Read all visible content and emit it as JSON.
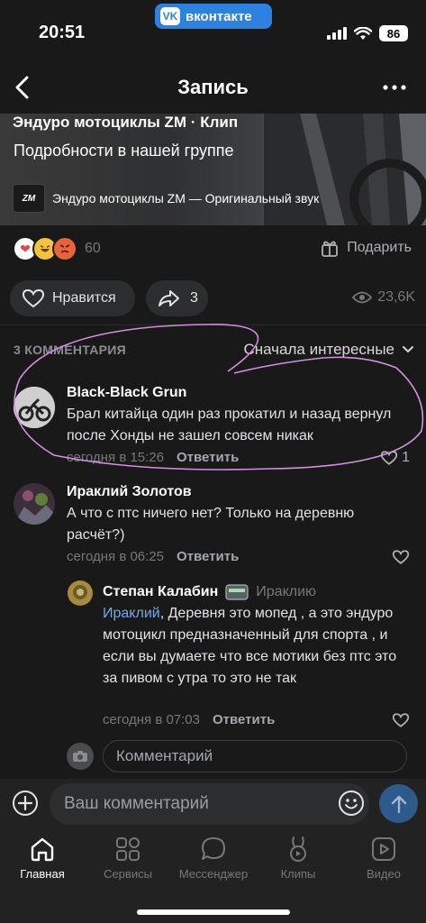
{
  "status_bar": {
    "time": "20:51",
    "app_pill": "вконтакте",
    "app_pill_logo": "VK",
    "battery": "86"
  },
  "header": {
    "title": "Запись"
  },
  "clip": {
    "title": "Эндуро мотоциклы ZM · Клип",
    "subtitle": "Подробности в нашей группе",
    "audio_logo": "ZM",
    "audio": "Эндуро мотоциклы ZM — Оригинальный звук"
  },
  "reactions": {
    "count": "60",
    "gift_label": "Подарить"
  },
  "actions": {
    "like_label": "Нравится",
    "share_count": "3",
    "views": "23,6K"
  },
  "comments_section": {
    "count_label": "3 КОММЕНТАРИЯ",
    "sort_label": "Сначала интересные"
  },
  "comments": [
    {
      "author": "Black-Black Grun",
      "text": "Брал китайца один раз прокатил и назад вернул после Хонды не зашел совсем никак",
      "time": "сегодня в 15:26",
      "reply_label": "Ответить",
      "likes": "1"
    },
    {
      "author": "Ираклий Золотов",
      "text": "А что с птс ничего нет? Только на деревню расчёт?)",
      "time": "сегодня в 06:25",
      "reply_label": "Ответить"
    }
  ],
  "reply": {
    "author": "Степан Калабин",
    "reply_to": "Ираклию",
    "mention": "Ираклий",
    "text": ", Деревня это мопед , а это эндуро мотоцикл предназначенный для спорта , и если вы думаете что все мотики без птс это за пивом с утра то это не так",
    "time": "сегодня в 07:03",
    "reply_label": "Ответить"
  },
  "inline_input": {
    "placeholder": "Комментарий"
  },
  "composer": {
    "placeholder": "Ваш комментарий"
  },
  "tabs": [
    {
      "label": "Главная",
      "icon": "home-icon",
      "active": true
    },
    {
      "label": "Сервисы",
      "icon": "services-icon"
    },
    {
      "label": "Мессенджер",
      "icon": "messenger-icon"
    },
    {
      "label": "Клипы",
      "icon": "clips-icon"
    },
    {
      "label": "Видео",
      "icon": "video-icon"
    }
  ],
  "colors": {
    "background": "#19191a",
    "accent": "#2d81e0",
    "mention": "#71aaeb",
    "annotation": "#d48fe0"
  }
}
